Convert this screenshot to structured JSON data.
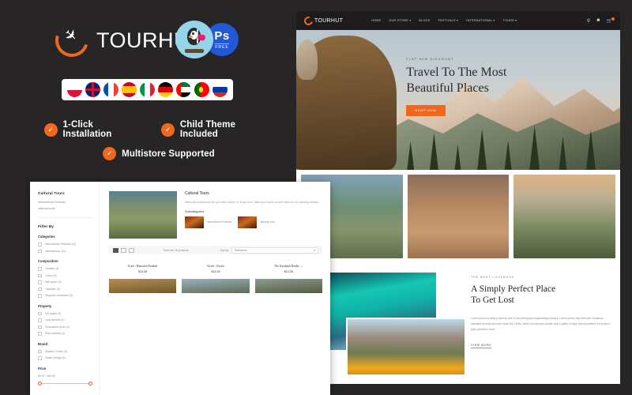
{
  "promo": {
    "brand_name": "TOURHUT",
    "badges": [
      {
        "name": "prestashop-badge",
        "label": ""
      },
      {
        "name": "photoshop-badge",
        "label": "Ps",
        "sub": "FREE"
      }
    ],
    "flags": [
      {
        "name": "poland"
      },
      {
        "name": "united-kingdom"
      },
      {
        "name": "france"
      },
      {
        "name": "spain"
      },
      {
        "name": "italy"
      },
      {
        "name": "germany"
      },
      {
        "name": "united-arab-emirates"
      },
      {
        "name": "portugal"
      },
      {
        "name": "russia"
      }
    ],
    "features": [
      "1-Click Installation",
      "Child Theme Included",
      "Multistore Supported"
    ],
    "accent_color": "#f2671f",
    "background_color": "#272525"
  },
  "site": {
    "logo": "TOURHUT",
    "nav": [
      "HOME",
      "OUR STORE ▾",
      "BLOGS",
      "FESTIVALS ▾",
      "INTERNATIONAL ▾",
      "TOURS ▾"
    ],
    "icons": [
      "search-icon",
      "account-icon",
      "cart-icon"
    ],
    "hero": {
      "kicker": "FLAT 50% DISCOUNT",
      "title_line1": "Travel To The Most",
      "title_line2": "Beautiful Places",
      "button": "SHOP NOW"
    },
    "gallery": [
      "coastal-village-photo",
      "camels-at-petra-photo",
      "boats-on-lake-photo"
    ],
    "lookbook": {
      "kicker": "THE BEST LOOKBOOK",
      "title_line1": "A Simply Perfect Place",
      "title_line2": "To Get Lost",
      "paragraph": "Lorem ipsum is simply dummy text of the printing and typesetting industry. Lorem Ipsum has been the industry's standard dummy text ever since the 1500s, when an unknown printer took a galley of type and scrambled it to make a type specimen book.",
      "link": "VIEW MORE"
    }
  },
  "category_page": {
    "sidebar": {
      "title": "Cultural Tours",
      "links": [
        "International Festivals",
        "national tours"
      ],
      "filter_title": "Filter By",
      "groups": [
        {
          "name": "Categories",
          "options": [
            "International Festivals (10)",
            "national tours (11)"
          ]
        },
        {
          "name": "Composition",
          "options": [
            "Ceramic (4)",
            "Cotton (2)",
            "Matt paper (2)",
            "Polyester (3)",
            "Recycled cardboard (3)"
          ]
        },
        {
          "name": "Property",
          "options": [
            "100 pages (2)",
            "Long sleeves (1)",
            "Removable cover (1)",
            "Short sleeves (1)"
          ]
        },
        {
          "name": "Brand",
          "options": [
            "Graphic Corner (9)",
            "Studio Design (9)"
          ]
        }
      ],
      "price_label": "Price",
      "price_range": "$9.00 - $44.00"
    },
    "main": {
      "title": "Cultural Tours",
      "description": "Items and accessories for your desk, kitchen or living room. Make your house a home with our eye-catching designs.",
      "subcategories_label": "Subcategories",
      "subcategories": [
        "International Festivals",
        "national tours"
      ],
      "toolbar": {
        "count": "There are 16 products.",
        "sort_label": "Sort by:",
        "sort_value": "Relevance"
      },
      "products": [
        {
          "name": "Kufri - Himachal Pradesh",
          "price": "$14.28"
        },
        {
          "name": "Kochi - Kerala",
          "price": "$14.28"
        },
        {
          "name": "The Karabakh Border -...",
          "price": "$14.28"
        }
      ]
    }
  }
}
